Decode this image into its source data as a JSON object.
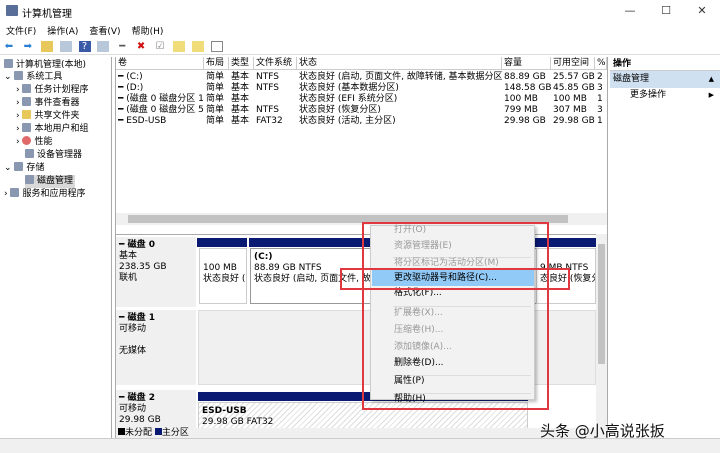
{
  "window": {
    "title": "计算机管理",
    "minimize": "—",
    "maximize": "☐",
    "close": "✕"
  },
  "menu": [
    "文件(F)",
    "操作(A)",
    "查看(V)",
    "帮助(H)"
  ],
  "toolbar": [
    "back-icon",
    "forward-icon",
    "up-folder-icon",
    "show-hide-tree-icon",
    "help-icon",
    "properties-icon",
    "disconnect-icon",
    "delete-icon",
    "check-icon",
    "new-icon",
    "export-icon",
    "window-icon"
  ],
  "tree": {
    "root": "计算机管理(本地)",
    "items": [
      {
        "label": "系统工具",
        "level": 1
      },
      {
        "label": "任务计划程序",
        "level": 2
      },
      {
        "label": "事件查看器",
        "level": 2
      },
      {
        "label": "共享文件夹",
        "level": 2
      },
      {
        "label": "本地用户和组",
        "level": 2
      },
      {
        "label": "性能",
        "level": 2
      },
      {
        "label": "设备管理器",
        "level": 2
      },
      {
        "label": "存储",
        "level": 1
      },
      {
        "label": "磁盘管理",
        "level": 2,
        "selected": true
      },
      {
        "label": "服务和应用程序",
        "level": 1
      }
    ]
  },
  "volume_table": {
    "headers": [
      "卷",
      "布局",
      "类型",
      "文件系统",
      "状态",
      "容量",
      "可用空间",
      "%"
    ],
    "rows": [
      [
        "(C:)",
        "简单",
        "基本",
        "NTFS",
        "状态良好 (启动, 页面文件, 故障转储, 基本数据分区)",
        "88.89 GB",
        "25.57 GB",
        "2"
      ],
      [
        "(D:)",
        "简单",
        "基本",
        "NTFS",
        "状态良好 (基本数据分区)",
        "148.58 GB",
        "45.85 GB",
        "3"
      ],
      [
        "(磁盘 0 磁盘分区 1)",
        "简单",
        "基本",
        "",
        "状态良好 (EFI 系统分区)",
        "100 MB",
        "100 MB",
        "1"
      ],
      [
        "(磁盘 0 磁盘分区 5)",
        "简单",
        "基本",
        "NTFS",
        "状态良好 (恢复分区)",
        "799 MB",
        "307 MB",
        "3"
      ],
      [
        "ESD-USB",
        "简单",
        "基本",
        "FAT32",
        "状态良好 (活动, 主分区)",
        "29.98 GB",
        "29.98 GB",
        "1"
      ]
    ]
  },
  "disks": [
    {
      "name": "磁盘 0",
      "type": "基本",
      "size": "238.35 GB",
      "status": "联机",
      "partitions": [
        {
          "title": "",
          "line1": "100 MB",
          "line2": "状态良好 (E"
        },
        {
          "title": "(C:)",
          "line1": "88.89 GB NTFS",
          "line2": "状态良好 (启动, 页面文件, 故障"
        },
        {
          "title": "",
          "line1": "9 MB NTFS",
          "line2": "态良好 (恢复分"
        }
      ]
    },
    {
      "name": "磁盘 1",
      "type": "可移动",
      "status": "无媒体"
    },
    {
      "name": "磁盘 2",
      "type": "可移动",
      "size": "29.98 GB",
      "partitions": [
        {
          "title": "ESD-USB",
          "line1": "29.98 GB FAT32"
        }
      ]
    }
  ],
  "legend": [
    {
      "label": "未分配",
      "color": "#000000"
    },
    {
      "label": "主分区",
      "color": "#0a1a72"
    }
  ],
  "actions": {
    "header": "操作",
    "section": "磁盘管理",
    "more": "更多操作"
  },
  "context_menu": [
    {
      "label": "打开(O)",
      "disabled": true
    },
    {
      "label": "资源管理器(E)",
      "disabled": true
    },
    {
      "label": "将分区标记为活动分区(M)",
      "disabled": true
    },
    {
      "label": "更改驱动器号和路径(C)...",
      "highlighted": true
    },
    {
      "label": "格式化(F)..."
    },
    {
      "label": "扩展卷(X)...",
      "disabled": true
    },
    {
      "label": "压缩卷(H)...",
      "disabled": true
    },
    {
      "label": "添加镜像(A)...",
      "disabled": true
    },
    {
      "label": "删除卷(D)..."
    },
    {
      "label": "属性(P)"
    },
    {
      "label": "帮助(H)"
    }
  ],
  "watermark": "头条 @小高说张扳",
  "colors": {
    "highlight": "#91c9f7",
    "partition_bar": "#0a1a72",
    "annotation": "#e0383e"
  }
}
